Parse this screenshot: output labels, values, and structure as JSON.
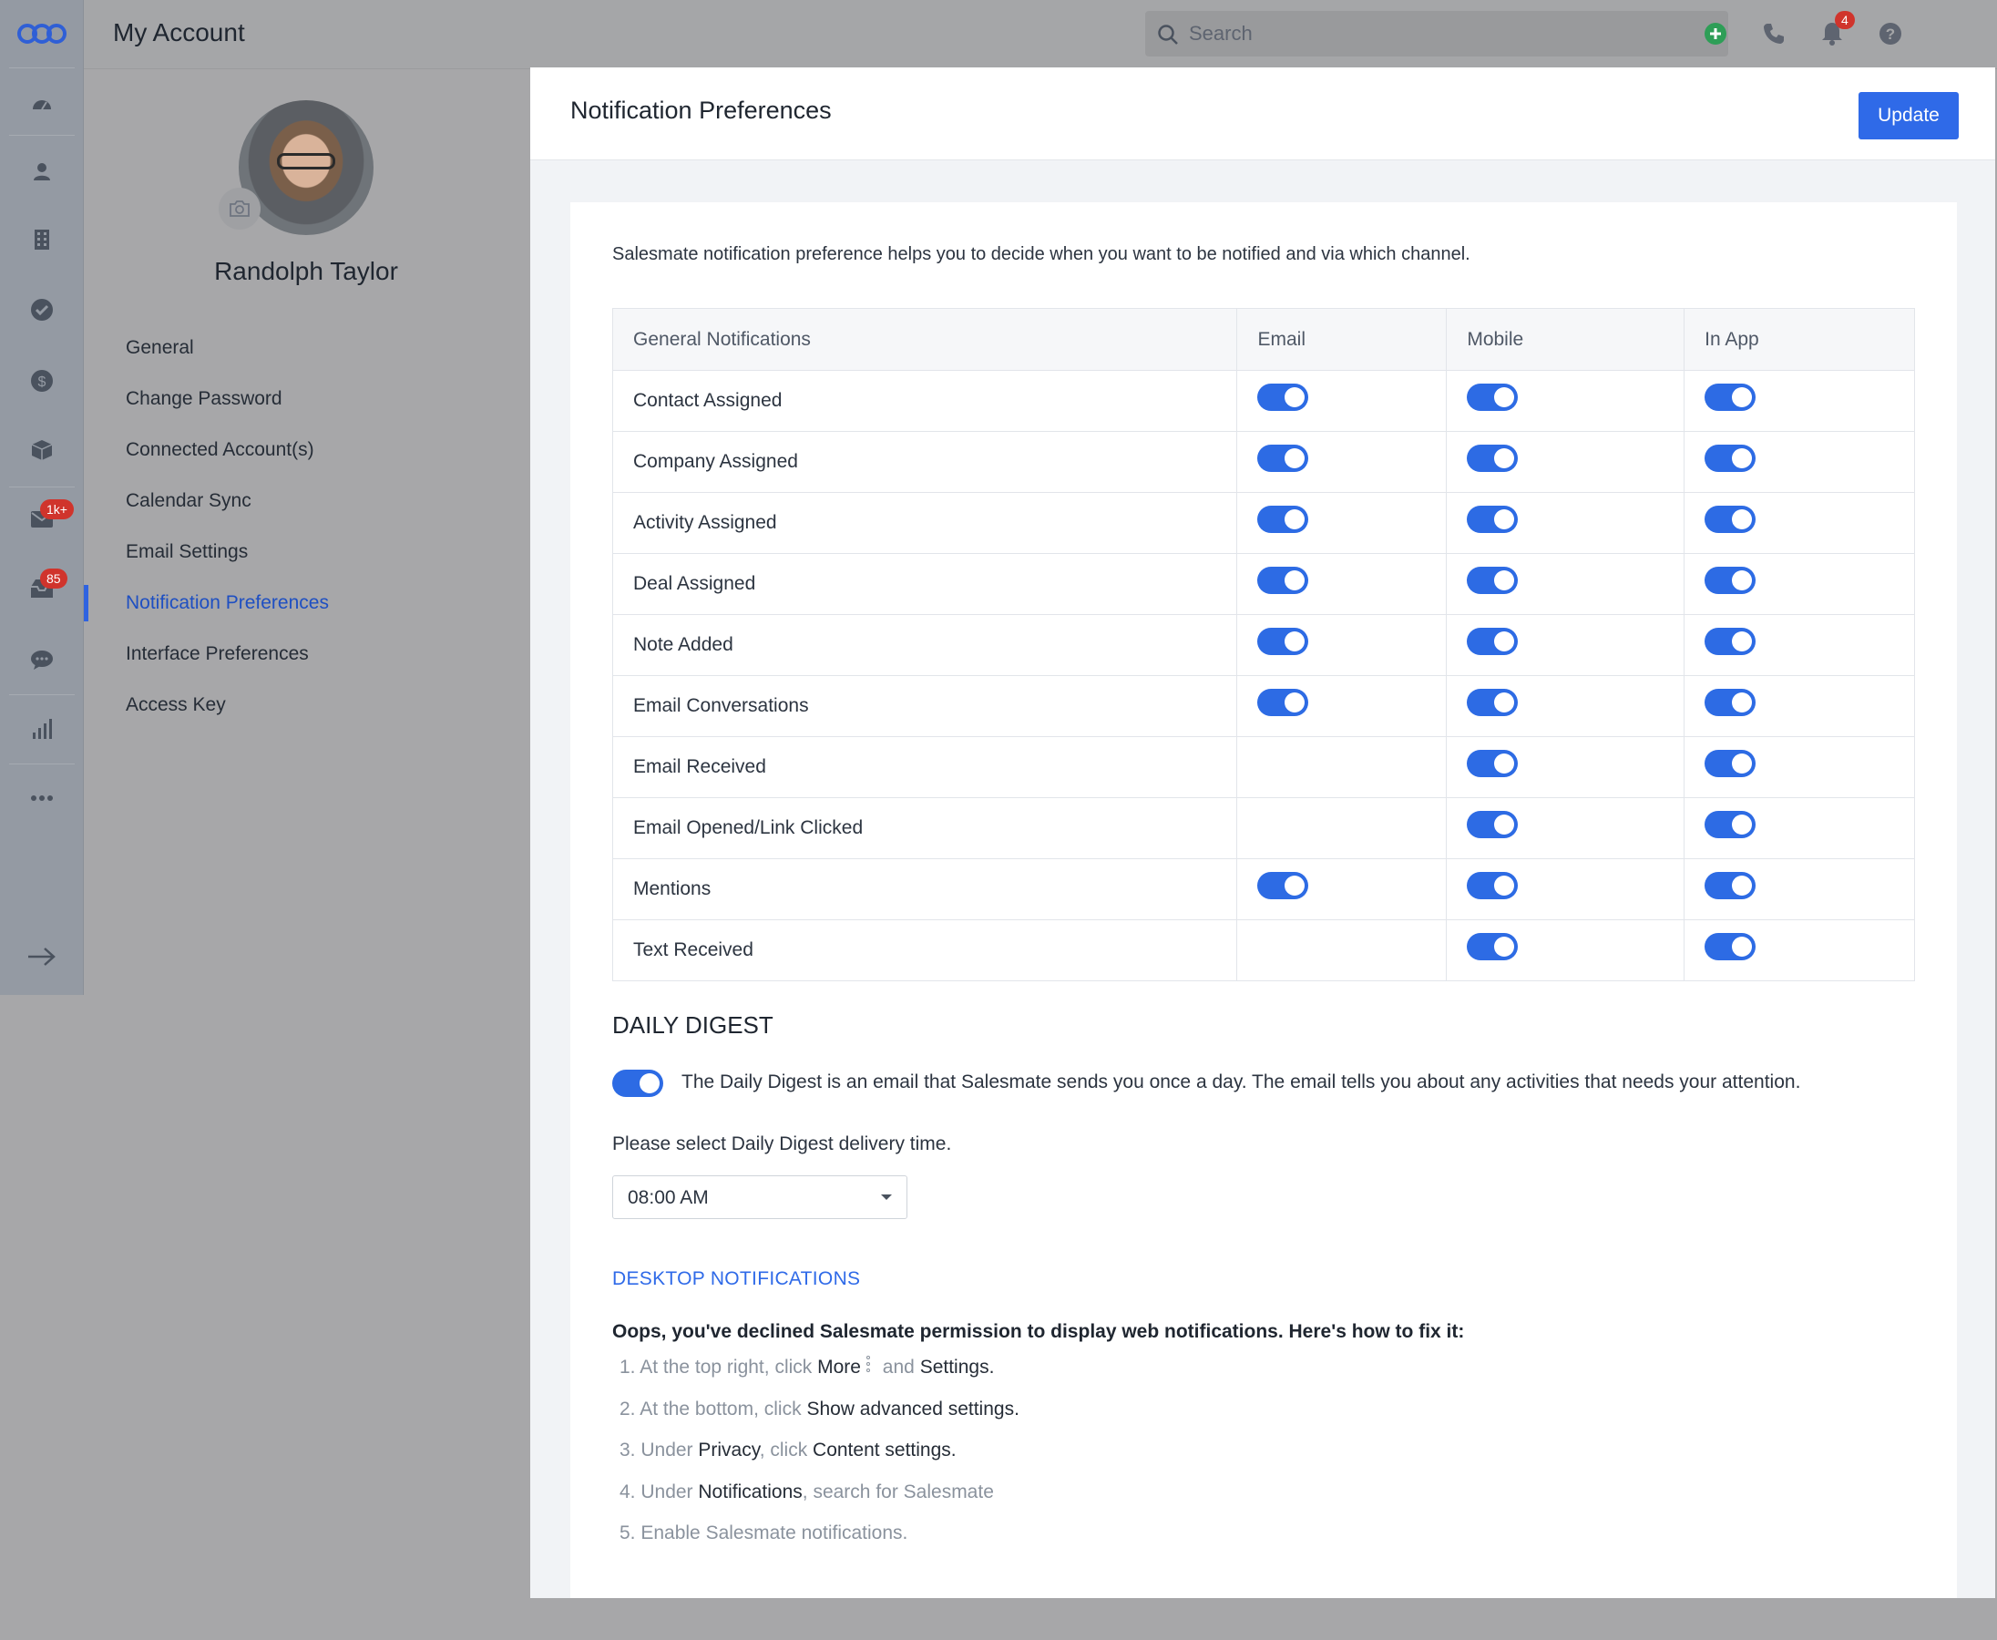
{
  "rail": {
    "badges": {
      "email": "1k+",
      "inbox": "85"
    }
  },
  "topbar": {
    "title": "My Account",
    "search_placeholder": "Search",
    "notification_count": "4"
  },
  "account": {
    "name": "Randolph Taylor",
    "menu": [
      {
        "label": "General"
      },
      {
        "label": "Change Password"
      },
      {
        "label": "Connected Account(s)"
      },
      {
        "label": "Calendar Sync"
      },
      {
        "label": "Email Settings"
      },
      {
        "label": "Notification Preferences",
        "active": true
      },
      {
        "label": "Interface Preferences"
      },
      {
        "label": "Access Key"
      }
    ]
  },
  "panel": {
    "title": "Notification Preferences",
    "update_label": "Update",
    "intro": "Salesmate notification preference helps you to decide when you want to be notified and via which channel.",
    "table": {
      "headers": [
        "General Notifications",
        "Email",
        "Mobile",
        "In App"
      ],
      "rows": [
        {
          "label": "Contact Assigned",
          "email": true,
          "mobile": true,
          "inapp": true
        },
        {
          "label": "Company Assigned",
          "email": true,
          "mobile": true,
          "inapp": true
        },
        {
          "label": "Activity Assigned",
          "email": true,
          "mobile": true,
          "inapp": true
        },
        {
          "label": "Deal Assigned",
          "email": true,
          "mobile": true,
          "inapp": true
        },
        {
          "label": "Note Added",
          "email": true,
          "mobile": true,
          "inapp": true
        },
        {
          "label": "Email Conversations",
          "email": true,
          "mobile": true,
          "inapp": true
        },
        {
          "label": "Email Received",
          "email": null,
          "mobile": true,
          "inapp": true
        },
        {
          "label": "Email Opened/Link Clicked",
          "email": null,
          "mobile": true,
          "inapp": true
        },
        {
          "label": "Mentions",
          "email": true,
          "mobile": true,
          "inapp": true
        },
        {
          "label": "Text Received",
          "email": null,
          "mobile": true,
          "inapp": true
        }
      ]
    },
    "daily_digest": {
      "title": "DAILY DIGEST",
      "enabled": true,
      "description": "The Daily Digest is an email that Salesmate sends you once a day. The email tells you about any activities that needs your attention.",
      "time_label": "Please select Daily Digest delivery time.",
      "time_value": "08:00 AM"
    },
    "desktop": {
      "title": "DESKTOP NOTIFICATIONS",
      "warning": "Oops, you've declined Salesmate permission to display web notifications. Here's how to fix it:",
      "steps": {
        "s1": {
          "a": "1. At the top right, click ",
          "b": "More",
          "c": " and ",
          "d": "Settings",
          "e": "."
        },
        "s2": {
          "a": "2. At the bottom, click ",
          "b": "Show advanced settings",
          "c": "."
        },
        "s3": {
          "a": "3. Under ",
          "b": "Privacy",
          "c": ", click ",
          "d": "Content settings",
          "e": "."
        },
        "s4": {
          "a": "4. Under ",
          "b": "Notifications",
          "c": ", search for Salesmate"
        },
        "s5": {
          "a": "5. Enable Salesmate notifications."
        }
      }
    }
  },
  "colors": {
    "accent": "#2f6ae8",
    "badge": "#d0342c",
    "add": "#2e9e57"
  }
}
